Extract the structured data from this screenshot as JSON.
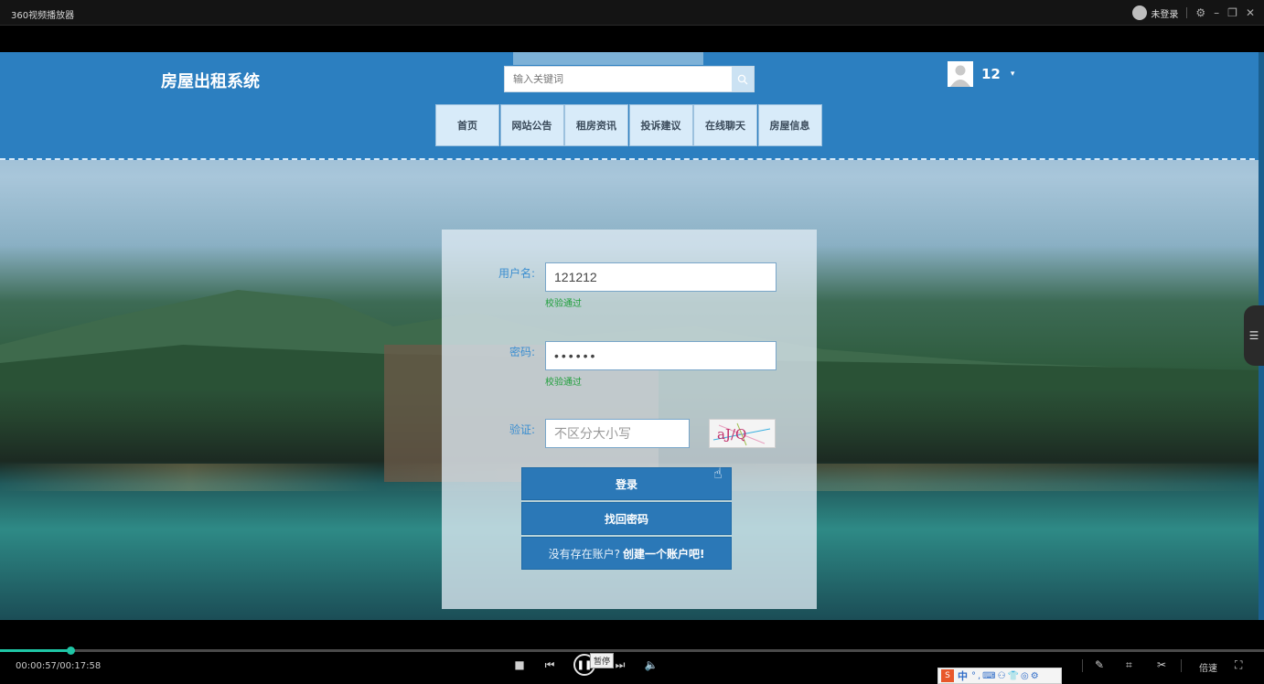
{
  "player": {
    "app_title": "360视频播放器",
    "login_status": "未登录",
    "time": "00:00:57/00:17:58",
    "progress": 0.056,
    "tooltip": "暂停",
    "speed_label": "倍速",
    "ime": {
      "mode": "中"
    }
  },
  "site": {
    "title": "房屋出租系统",
    "search_placeholder": "输入关键词",
    "username": "12",
    "nav": [
      "首页",
      "网站公告",
      "租房资讯",
      "投诉建议",
      "在线聊天",
      "房屋信息"
    ]
  },
  "login": {
    "username_label": "用户名:",
    "username_value": "121212",
    "username_status": "校验通过",
    "password_label": "密码:",
    "password_value": "••••••",
    "password_status": "校验通过",
    "captcha_label": "验证:",
    "captcha_placeholder": "不区分大小写",
    "captcha_text": "aJ/Q",
    "login_button": "登录",
    "recover_button": "找回密码",
    "register_prompt": "没有存在账户?",
    "register_link": "创建一个账户吧!"
  }
}
